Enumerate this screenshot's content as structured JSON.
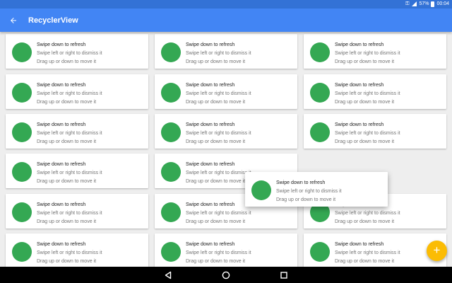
{
  "status_bar": {
    "battery": "57%",
    "time": "00:04",
    "icons": [
      "key-icon",
      "signal-icon",
      "battery-icon"
    ]
  },
  "app_bar": {
    "title": "RecyclerView",
    "nav_icon": "back-arrow-icon"
  },
  "item_template": {
    "title": "Swipe down to refresh",
    "line2": "Swipe left or right to dismiss it",
    "line3": "Drag up or down to move it"
  },
  "dragged_item": {
    "title": "Swipe down to refresh",
    "line2": "Swipe left or right to dismiss it",
    "line3": "Drag up or down to move it"
  },
  "grid": {
    "rows_per_column": 6,
    "columns": 3,
    "empty_slot": "row 4, column 3 (item being dragged)"
  },
  "fab": {
    "icon": "plus-icon",
    "label": "+"
  },
  "nav_bar": {
    "icons": [
      "back-triangle-icon",
      "home-circle-icon",
      "recents-square-icon"
    ]
  },
  "colors": {
    "status_bar": "#3372d6",
    "app_bar": "#4285f4",
    "avatar": "#34a853",
    "fab": "#fbbc04",
    "background": "#eeeeee"
  }
}
